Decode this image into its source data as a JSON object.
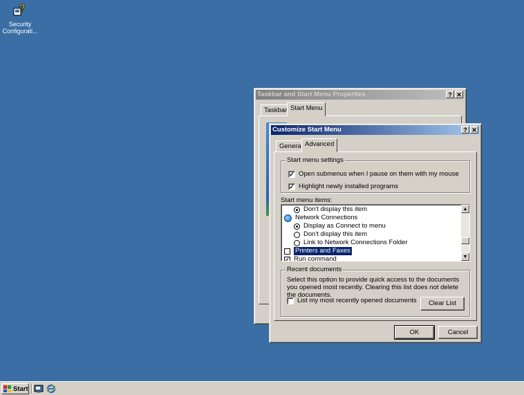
{
  "desktop": {
    "icons": [
      {
        "label": "Security Configurati...",
        "icon": "security-config-icon"
      }
    ]
  },
  "back_window": {
    "title": "Taskbar and Start Menu Properties",
    "tabs": [
      "Taskbar",
      "Start Menu"
    ],
    "selected_tab": "Start Menu"
  },
  "dialog": {
    "title": "Customize Start Menu",
    "tabs": [
      "General",
      "Advanced"
    ],
    "selected_tab": "Advanced",
    "settings_group": {
      "label": "Start menu settings",
      "options": [
        {
          "label": "Open submenus when I pause on them with my mouse",
          "checked": true
        },
        {
          "label": "Highlight newly installed programs",
          "checked": true
        }
      ]
    },
    "items_label": "Start menu items:",
    "items": [
      {
        "type": "radio",
        "label": "Don't display this item",
        "checked": true
      },
      {
        "type": "node",
        "label": "Network Connections",
        "icon": "network-connections-icon"
      },
      {
        "type": "radio",
        "label": "Display as Connect to menu",
        "checked": true
      },
      {
        "type": "radio",
        "label": "Don't display this item",
        "checked": false
      },
      {
        "type": "radio",
        "label": "Link to Network Connections Folder",
        "checked": false
      },
      {
        "type": "checkbox",
        "label": "Printers and Faxes",
        "checked": false,
        "selected": true
      },
      {
        "type": "checkbox",
        "label": "Run command",
        "checked": true
      }
    ],
    "recent_group": {
      "label": "Recent documents",
      "description": "Select this option to provide quick access to the documents you opened most recently.  Clearing this list does not delete the documents.",
      "option_label": "List my most recently opened documents",
      "option_checked": false,
      "clear_button": "Clear List"
    },
    "ok_button": "OK",
    "cancel_button": "Cancel"
  },
  "taskbar": {
    "start_label": "Start",
    "quicklaunch": [
      "show-desktop-icon",
      "internet-explorer-icon"
    ]
  }
}
